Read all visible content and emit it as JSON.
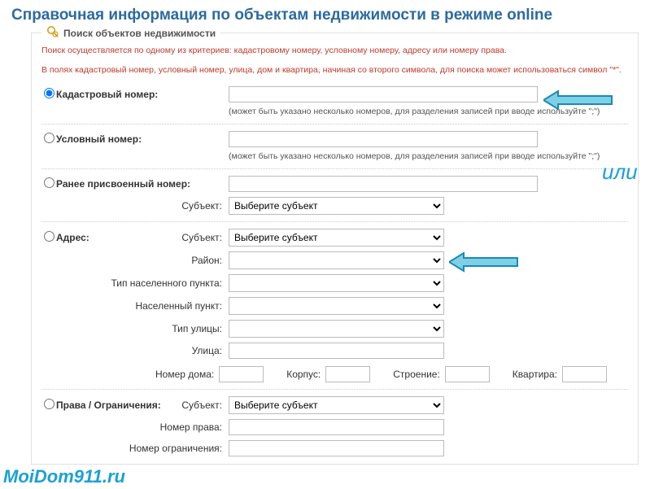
{
  "title": "Справочная информация по объектам недвижимости в режиме online",
  "legend": "Поиск объектов недвижимости",
  "warn1": "Поиск осуществляется по одному из критериев: кадастровому номеру, условному номеру, адресу или номеру права.",
  "warn2": "В полях кадастровый номер, условный номер, улица, дом и квартира, начиная со второго символа, для поиска может использоваться символ \"*\".",
  "cadastral": {
    "label": "Кадастровый номер:",
    "hint": "(может быть указано несколько номеров, для разделения записей при вводе используйте \";\")"
  },
  "conditional": {
    "label": "Условный номер:",
    "hint": "(может быть указано несколько номеров, для разделения записей при вводе используйте \";\")"
  },
  "previous": {
    "label": "Ранее присвоенный номер:",
    "subject_label": "Субъект:",
    "subject_placeholder": "Выберите субъект"
  },
  "address": {
    "label": "Адрес:",
    "subject_label": "Субъект:",
    "subject_placeholder": "Выберите субъект",
    "district_label": "Район:",
    "settlement_type_label": "Тип населенного пункта:",
    "settlement_label": "Населенный пункт:",
    "street_type_label": "Тип улицы:",
    "street_label": "Улица:",
    "house_label": "Номер дома:",
    "korpus_label": "Корпус:",
    "building_label": "Строение:",
    "flat_label": "Квартира:"
  },
  "rights": {
    "label": "Права / Ограничения:",
    "subject_label": "Субъект:",
    "subject_placeholder": "Выберите субъект",
    "right_no_label": "Номер права:",
    "restrict_no_label": "Номер ограничения:"
  },
  "overlay": {
    "or": "или",
    "watermark": "MoiDom911.ru"
  }
}
